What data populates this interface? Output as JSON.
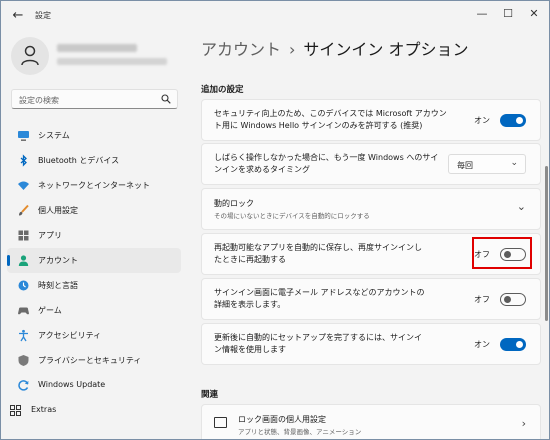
{
  "window": {
    "title": "設定",
    "back_glyph": "←",
    "min_glyph": "—",
    "max_glyph": "☐",
    "close_glyph": "✕"
  },
  "sidebar": {
    "search_placeholder": "設定の検索",
    "items": [
      {
        "label": "システム",
        "icon": "monitor-icon",
        "active": false
      },
      {
        "label": "Bluetooth とデバイス",
        "icon": "bluetooth-icon",
        "active": false
      },
      {
        "label": "ネットワークとインターネット",
        "icon": "wifi-icon",
        "active": false
      },
      {
        "label": "個人用設定",
        "icon": "brush-icon",
        "active": false
      },
      {
        "label": "アプリ",
        "icon": "apps-icon",
        "active": false
      },
      {
        "label": "アカウント",
        "icon": "person-icon",
        "active": true
      },
      {
        "label": "時刻と言語",
        "icon": "clock-globe-icon",
        "active": false
      },
      {
        "label": "ゲーム",
        "icon": "gamepad-icon",
        "active": false
      },
      {
        "label": "アクセシビリティ",
        "icon": "accessibility-icon",
        "active": false
      },
      {
        "label": "プライバシーとセキュリティ",
        "icon": "shield-icon",
        "active": false
      },
      {
        "label": "Windows Update",
        "icon": "update-icon",
        "active": false
      },
      {
        "label": "Extras",
        "icon": "extras-icon",
        "active": false
      }
    ]
  },
  "main": {
    "breadcrumb_parent": "アカウント",
    "breadcrumb_sep": "›",
    "breadcrumb_current": "サインイン オプション",
    "section_additional": "追加の設定",
    "section_related": "関連",
    "settings": {
      "hello_only": {
        "text": "セキュリティ向上のため、このデバイスでは Microsoft アカウント用に Windows Hello サインインのみを許可する (推奨)",
        "state_label": "オン",
        "on": true
      },
      "signin_timing": {
        "text": "しばらく操作しなかった場合に、もう一度 Windows へのサインインを求めるタイミング",
        "value": "毎回"
      },
      "dynamic_lock": {
        "title": "動的ロック",
        "subtitle": "その場にいないときにデバイスを自動的にロックする"
      },
      "restart_apps": {
        "text": "再起動可能なアプリを自動的に保存し、再度サインインしたときに再起動する",
        "state_label": "オフ",
        "on": false
      },
      "show_details": {
        "text": "サインイン画面に電子メール アドレスなどのアカウントの詳細を表示します。",
        "state_label": "オフ",
        "on": false
      },
      "auto_finish_setup": {
        "text": "更新後に自動的にセットアップを完了するには、サインイン情報を使用します",
        "state_label": "オン",
        "on": true
      }
    },
    "related": {
      "lockscreen": {
        "title": "ロック画面の個人用設定",
        "subtitle": "アプリと状態、背景画像、アニメーション"
      }
    }
  },
  "colors": {
    "accent": "#0067c0",
    "highlight_box": "#e00000",
    "background": "#f3f3f3",
    "card": "#fbfbfb"
  }
}
